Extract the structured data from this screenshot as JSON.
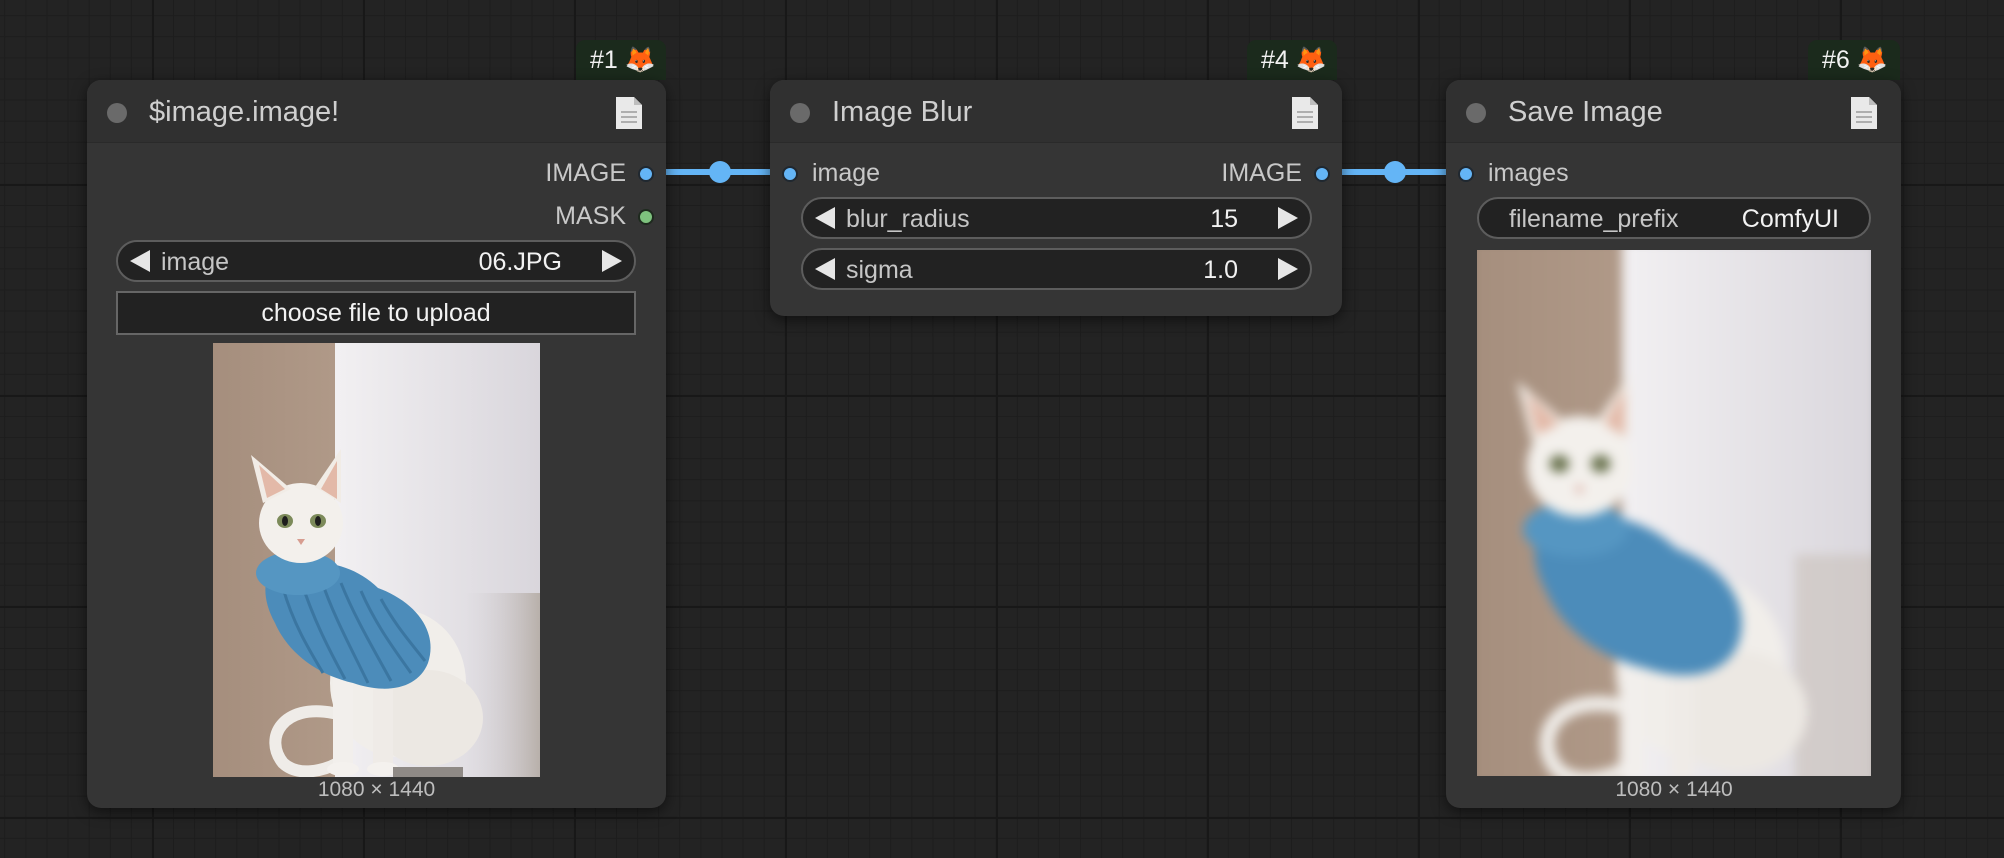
{
  "nodes": {
    "load_image": {
      "badge": "#1",
      "title": "$image.image!",
      "outputs": [
        "IMAGE",
        "MASK"
      ],
      "image_widget": {
        "name": "image",
        "value": "06.JPG"
      },
      "upload_label": "choose file to upload",
      "preview_dimensions": "1080 × 1440"
    },
    "image_blur": {
      "badge": "#4",
      "title": "Image Blur",
      "input": "image",
      "output": "IMAGE",
      "widgets": [
        {
          "name": "blur_radius",
          "value": "15"
        },
        {
          "name": "sigma",
          "value": "1.0"
        }
      ]
    },
    "save_image": {
      "badge": "#6",
      "title": "Save Image",
      "input": "images",
      "prefix_widget": {
        "name": "filename_prefix",
        "value": "ComfyUI"
      },
      "preview_dimensions": "1080 × 1440"
    }
  },
  "colors": {
    "canvas": "#232323",
    "node_body": "#353535",
    "link_image": "#64b5f6",
    "slot_mask": "#7ec27e",
    "badge_bg": "#1b2a1c"
  },
  "icons": {
    "badge": "fox-icon",
    "header_right": "document-icon",
    "status": "status-dot-icon"
  }
}
